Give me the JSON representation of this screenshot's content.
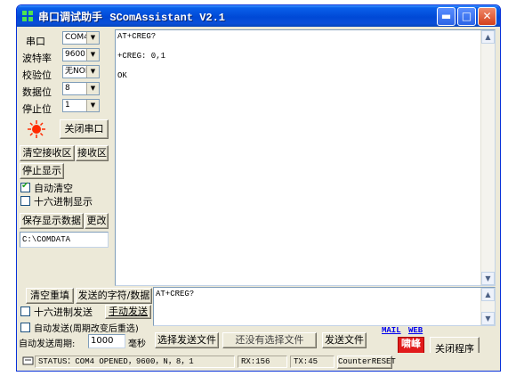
{
  "window": {
    "title_cn": "串口调试助手",
    "title_en": "SComAssistant V2.1",
    "controls": [
      "minimize-icon",
      "maximize-icon",
      "close-icon"
    ]
  },
  "serial": {
    "port_label": "串口",
    "port_value": "COM4",
    "baud_label": "波特率",
    "baud_value": "9600",
    "parity_label": "校验位",
    "parity_value": "无NON",
    "databits_label": "数据位",
    "databits_value": "8",
    "stopbits_label": "停止位",
    "stopbits_value": "1",
    "close_port_button": "关闭串口",
    "status_light_color": "#ff2a00"
  },
  "receive_controls": {
    "clear_button": "清空接收区",
    "receive_area_button": "接收区",
    "stop_display_button": "停止显示",
    "auto_clear_label": "自动清空",
    "auto_clear_checked": true,
    "hex_display_label": "十六进制显示",
    "hex_display_checked": false,
    "save_data_button": "保存显示数据",
    "change_button": "更改",
    "save_path": "C:\\COMDATA"
  },
  "receive_area": {
    "lines": [
      "AT+CREG?",
      "",
      "+CREG: 0,1",
      "",
      "OK"
    ]
  },
  "send_controls": {
    "clear_resend_button": "清空重填",
    "send_char_button": "发送的字符/数据",
    "hex_send_label": "十六进制发送",
    "manual_send_button": "手动发送",
    "auto_send_label": "自动发送(周期改变后重选)",
    "period_label": "自动发送周期:",
    "period_value": "1000",
    "period_unit": "毫秒",
    "select_file_button": "选择发送文件",
    "file_status": "还没有选择文件",
    "send_file_button": "发送文件",
    "exit_button": "关闭程序"
  },
  "send_area": {
    "text": "AT+CREG?"
  },
  "links": {
    "mail": "MAIL",
    "web": "WEB"
  },
  "logo": {
    "line1": "啸峰",
    "line2": "STUDIO"
  },
  "status_bar": {
    "status": "STATUS：COM4 OPENED，9600，N，8，1",
    "rx": "RX:156",
    "tx": "TX:45",
    "reset_button": "CounterRESET"
  }
}
